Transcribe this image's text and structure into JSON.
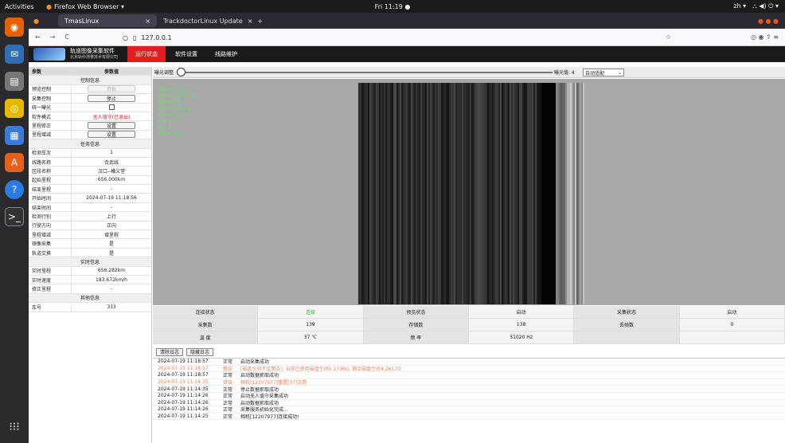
{
  "topbar": {
    "activities": "Activities",
    "app": "Firefox Web Browser ▾",
    "clock": "Fri 11:19 ●",
    "lang": "zh ▾",
    "tray": "⛬ ◀) ⏻ ▾"
  },
  "tabs": [
    {
      "label": "TmasLinux",
      "close": "×"
    },
    {
      "label": "TrackdoctorLinux Update",
      "close": "×",
      "add": "+"
    }
  ],
  "nav": {
    "url": "127.0.0.1",
    "back": "←",
    "forward": "→",
    "reload": "C"
  },
  "banner": {
    "title": "轨道图像采集软件",
    "subtitle": "北京轨科测量技术有限公司",
    "tabs": [
      "运行状态",
      "软件设置",
      "线路维护"
    ]
  },
  "left": {
    "header": [
      "参数",
      "参数值"
    ],
    "sec_control": "控制信息",
    "control": [
      {
        "k": "预览控制",
        "btn": "开始"
      },
      {
        "k": "采集控制",
        "btn": "停止"
      },
      {
        "k": "统一曝光"
      },
      {
        "k": "软件模式",
        "v": "无人值守(已退出)"
      },
      {
        "k": "里程修正",
        "btn": "设置"
      },
      {
        "k": "里程增减",
        "btn": "设置"
      }
    ],
    "sec_task": "任务信息",
    "task": [
      {
        "k": "检测车次",
        "v": "1"
      },
      {
        "k": "线路名称",
        "v": "合武线"
      },
      {
        "k": "区段名称",
        "v": "汉口--横义堂"
      },
      {
        "k": "起始里程",
        "v": "656.000km"
      },
      {
        "k": "结束里程",
        "v": "-"
      },
      {
        "k": "开始时间",
        "v": "2024-07-19 11:18:56"
      },
      {
        "k": "结束时间",
        "v": "-"
      },
      {
        "k": "检测行别",
        "v": "上行"
      },
      {
        "k": "行驶方向",
        "v": "正向"
      },
      {
        "k": "里程增减",
        "v": "增里程"
      },
      {
        "k": "镜像采集",
        "v": "是"
      },
      {
        "k": "轨道交换",
        "v": "是"
      }
    ],
    "sec_rt": "实时信息",
    "rt": [
      {
        "k": "实时里程",
        "v": "656.282km"
      },
      {
        "k": "实时速度",
        "v": "183.672km/h"
      },
      {
        "k": "修正里程",
        "v": "-"
      }
    ],
    "sec_other": "其他信息",
    "other": [
      {
        "k": "车号",
        "v": "333"
      }
    ]
  },
  "exposure": {
    "label": "曝光调整",
    "value": "曝光值: 4",
    "mode": "自动适配"
  },
  "overlay": [
    "里程: 656.282km",
    "速度: 183.672km/h",
    "线路: 合武线",
    "区段: 汉口--横义堂",
    "时间: 11:18:57",
    "行别: 上行",
    "曝光: 4",
    "帧率: 51020 Hz"
  ],
  "stats": {
    "r1": [
      "连接状态",
      "连接",
      "预览状态",
      "启动",
      "采集状态",
      "启动"
    ],
    "r2": [
      "采集数",
      "139",
      "存储数",
      "138",
      "丢帧数",
      "0"
    ],
    "r3": [
      "温 度",
      "37 ℃",
      "频 率",
      "51020 Hz"
    ]
  },
  "logbuttons": [
    "清除日志",
    "隐藏日志"
  ],
  "logs": [
    {
      "t": "2024-07-19 11:18:57",
      "l": "正常",
      "m": "启动采集成功",
      "w": false
    },
    {
      "t": "2024-07-19 11:18:57",
      "l": "警告",
      "m": "[磁盘空间不足警告]: 当前已使用磁盘空间0.1736G, 剩余磁盘空间4.2617G",
      "w": true
    },
    {
      "t": "2024-07-19 11:18:57",
      "l": "正常",
      "m": "启动数据抓取成功",
      "w": false
    },
    {
      "t": "2024-07-19 11:14:35",
      "l": "错误",
      "m": "相机[12207977]重置[37]次数",
      "w": true
    },
    {
      "t": "2024-07-19 11:14:35",
      "l": "正常",
      "m": "停止数据抓取成功",
      "w": false
    },
    {
      "t": "2024-07-19 11:14:26",
      "l": "正常",
      "m": "启动无人值守采集成功",
      "w": false
    },
    {
      "t": "2024-07-19 11:14:26",
      "l": "正常",
      "m": "启动数据抓取成功",
      "w": false
    },
    {
      "t": "2024-07-19 11:14:26",
      "l": "正常",
      "m": "采集服务初始化完成...",
      "w": false
    },
    {
      "t": "2024-07-19 11:14:25",
      "l": "正常",
      "m": "相机[12207977]连接成功!",
      "w": false
    }
  ]
}
